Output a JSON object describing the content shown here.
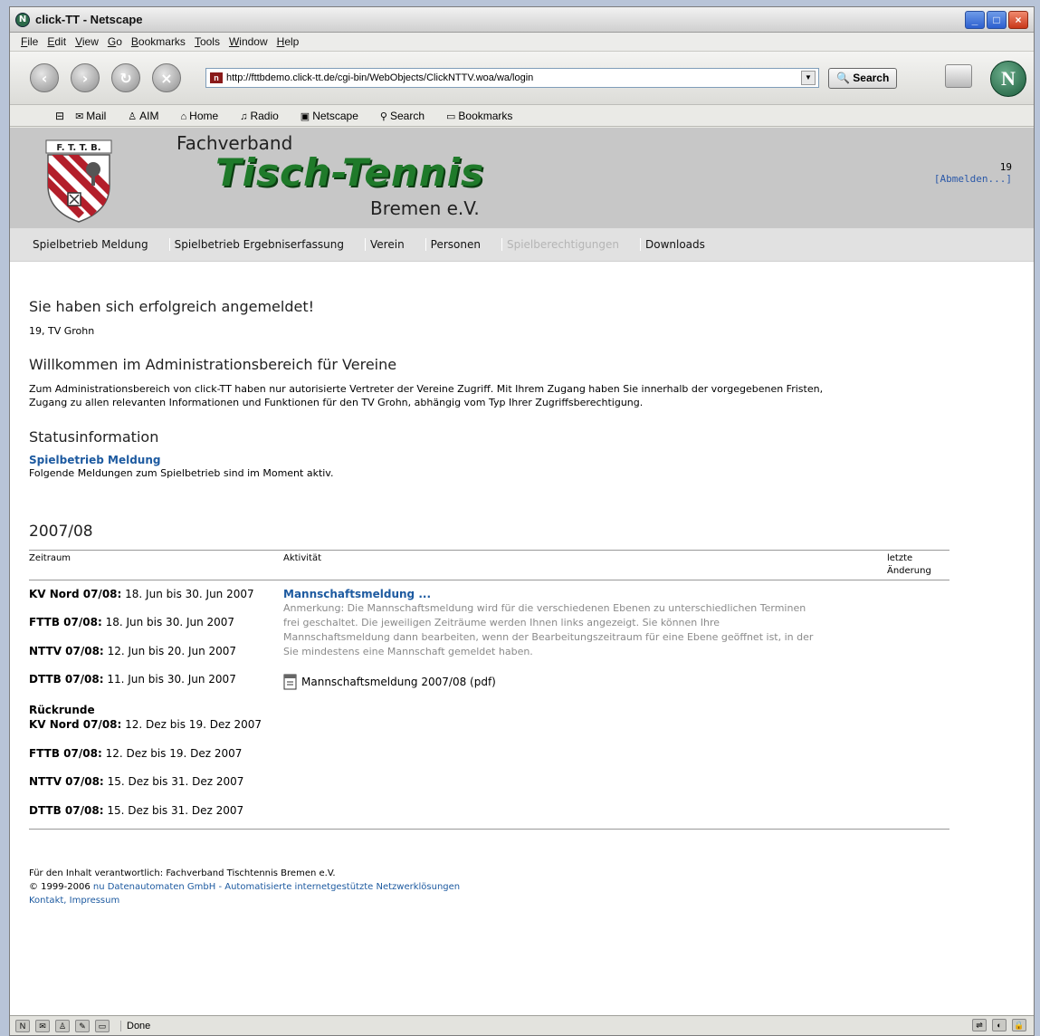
{
  "window": {
    "title": "click-TT - Netscape",
    "app_icon": "netscape-logo-icon"
  },
  "menu": [
    "File",
    "Edit",
    "View",
    "Go",
    "Bookmarks",
    "Tools",
    "Window",
    "Help"
  ],
  "nav": {
    "url": "http://fttbdemo.click-tt.de/cgi-bin/WebObjects/ClickNTTV.woa/wa/login",
    "search_label": "Search"
  },
  "personal_toolbar": [
    "Mail",
    "AIM",
    "Home",
    "Radio",
    "Netscape",
    "Search",
    "Bookmarks"
  ],
  "header": {
    "logo_text": "F. T. T. B.",
    "fachverband": "Fachverband",
    "tischtennis": "Tisch-Tennis",
    "bremen": "Bremen e.V.",
    "user_number": "19",
    "logout": "[Abmelden...]"
  },
  "mainnav": [
    {
      "label": "Spielbetrieb Meldung",
      "disabled": false
    },
    {
      "label": "Spielbetrieb Ergebniserfassung",
      "disabled": false
    },
    {
      "label": "Verein",
      "disabled": false
    },
    {
      "label": "Personen",
      "disabled": false
    },
    {
      "label": "Spielberechtigungen",
      "disabled": true
    },
    {
      "label": "Downloads",
      "disabled": false
    }
  ],
  "content": {
    "success": "Sie haben sich erfolgreich angemeldet!",
    "club": "19, TV Grohn",
    "welcome_title": "Willkommen im Administrationsbereich für Vereine",
    "welcome_text_1": "Zum Administrationsbereich von click-TT haben nur autorisierte Vertreter der Vereine Zugriff. Mit Ihrem Zugang haben Sie innerhalb der vorgegebenen Fristen,",
    "welcome_text_2": "Zugang zu allen relevanten Informationen und Funktionen für den TV Grohn, abhängig vom Typ Ihrer Zugriffsberechtigung.",
    "status_title": "Statusinformation",
    "status_link": "Spielbetrieb Meldung",
    "status_text": "Folgende Meldungen zum Spielbetrieb sind im Moment aktiv."
  },
  "season": "2007/08",
  "table": {
    "headers": {
      "period": "Zeitraum",
      "activity": "Aktivität",
      "changed_1": "letzte",
      "changed_2": "Änderung"
    },
    "periods": [
      {
        "label": "KV Nord 07/08:",
        "range": "18. Jun bis 30. Jun 2007"
      },
      {
        "label": "FTTB 07/08:",
        "range": "18. Jun bis 30. Jun 2007"
      },
      {
        "label": "NTTV 07/08:",
        "range": "12. Jun bis 20. Jun 2007"
      },
      {
        "label": "DTTB 07/08:",
        "range": "11. Jun bis 30. Jun 2007"
      }
    ],
    "rueckrunde_label": "Rückrunde",
    "rueckrunde_periods": [
      {
        "label": "KV Nord 07/08:",
        "range": "12. Dez bis 19. Dez 2007"
      },
      {
        "label": "FTTB 07/08:",
        "range": "12. Dez bis 19. Dez 2007"
      },
      {
        "label": "NTTV 07/08:",
        "range": "15. Dez bis 31. Dez 2007"
      },
      {
        "label": "DTTB 07/08:",
        "range": "15. Dez bis 31. Dez 2007"
      }
    ],
    "activity_title": "Mannschaftsmeldung ...",
    "activity_note_1": "Anmerkung: Die Mannschaftsmeldung wird für die verschiedenen Ebenen zu unterschiedlichen Terminen",
    "activity_note_2": "frei geschaltet. Die jeweiligen Zeiträume werden Ihnen links angezeigt. Sie können Ihre",
    "activity_note_3": "Mannschaftsmeldung dann bearbeiten, wenn der Bearbeitungszeitraum für eine Ebene geöffnet ist, in der",
    "activity_note_4": "Sie mindestens eine Mannschaft gemeldet haben.",
    "pdf_link": "Mannschaftsmeldung 2007/08 (pdf)"
  },
  "footer": {
    "responsible": "Für den Inhalt verantwortlich: Fachverband Tischtennis Bremen e.V.",
    "copyright_prefix": "© 1999-2006",
    "copyright_link": "nu Datenautomaten GmbH - Automatisierte internetgestützte Netzwerklösungen",
    "contact": "Kontakt, Impressum"
  },
  "statusbar": {
    "text": "Done"
  },
  "colors": {
    "link": "#1d5aa0",
    "header_bg": "#c7c7c7",
    "nav_bg": "#e1e1e1",
    "logo_green": "#1f7a2a"
  }
}
